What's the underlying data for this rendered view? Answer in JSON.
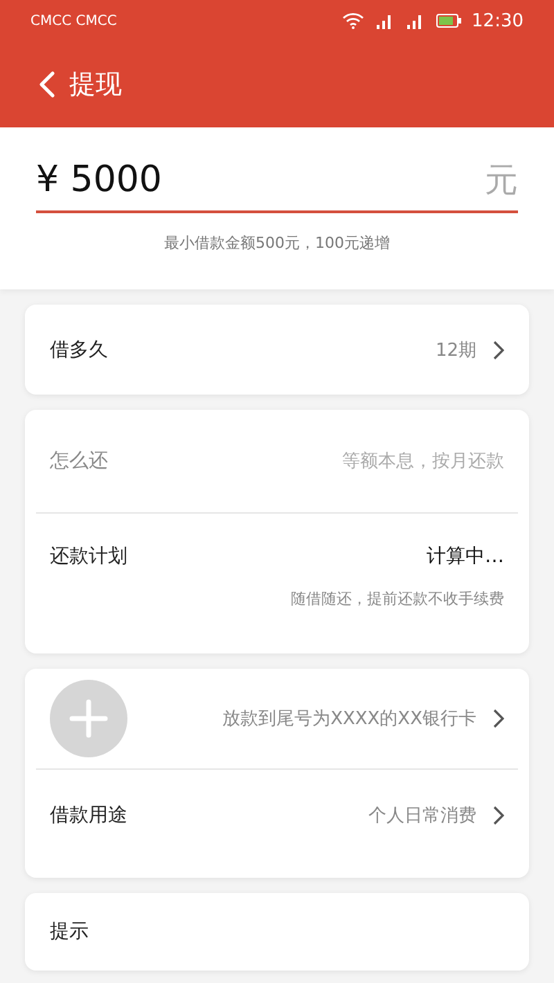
{
  "status_bar": {
    "carrier": "CMCC CMCC",
    "time": "12:30"
  },
  "header": {
    "title": "提现"
  },
  "amount": {
    "value": "¥ 5000",
    "unit": "元",
    "hint": "最小借款金额500元，100元递增"
  },
  "term": {
    "label": "借多久",
    "value": "12期"
  },
  "repayment": {
    "method_label": "怎么还",
    "method_value": "等额本息，按月还款",
    "plan_label": "还款计划",
    "plan_value": "计算中…",
    "plan_note": "随借随还，提前还款不收手续费"
  },
  "payout": {
    "account": "放款到尾号为XXXX的XX银行卡",
    "purpose_label": "借款用途",
    "purpose_value": "个人日常消费"
  },
  "tips": {
    "label": "提示"
  }
}
